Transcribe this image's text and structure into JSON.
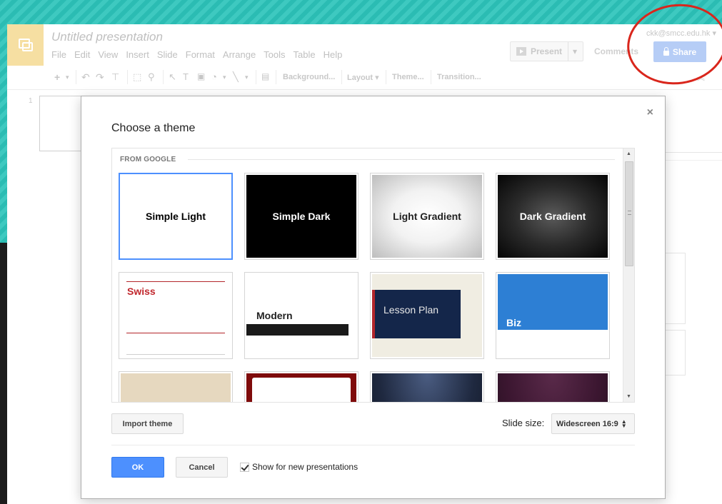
{
  "app": {
    "title": "Untitled presentation",
    "account": "ckk@smcc.edu.hk ▾",
    "menu": [
      "File",
      "Edit",
      "View",
      "Insert",
      "Slide",
      "Format",
      "Arrange",
      "Tools",
      "Table",
      "Help"
    ],
    "present_label": "Present",
    "comments_label": "Comments",
    "share_label": "Share",
    "slide_number": "1",
    "toolbar": {
      "background_label": "Background...",
      "layout_label": "Layout ▾",
      "theme_label": "Theme...",
      "transition_label": "Transition..."
    }
  },
  "dialog": {
    "title": "Choose a theme",
    "close_glyph": "×",
    "section_label": "FROM GOOGLE",
    "themes": [
      {
        "name": "Simple Light",
        "selected": true
      },
      {
        "name": "Simple Dark"
      },
      {
        "name": "Light Gradient"
      },
      {
        "name": "Dark Gradient"
      },
      {
        "name": "Swiss"
      },
      {
        "name": "Modern"
      },
      {
        "name": "Lesson Plan"
      },
      {
        "name": "Biz"
      }
    ],
    "import_label": "Import theme",
    "slide_size_label": "Slide size:",
    "slide_size_value": "Widescreen 16:9",
    "ok_label": "OK",
    "cancel_label": "Cancel",
    "show_label": "Show for new presentations",
    "show_checked": true
  },
  "colors": {
    "accent_blue": "#4d90fe",
    "annotation_red": "#d9261c",
    "background_teal": "#2bbcb3"
  }
}
